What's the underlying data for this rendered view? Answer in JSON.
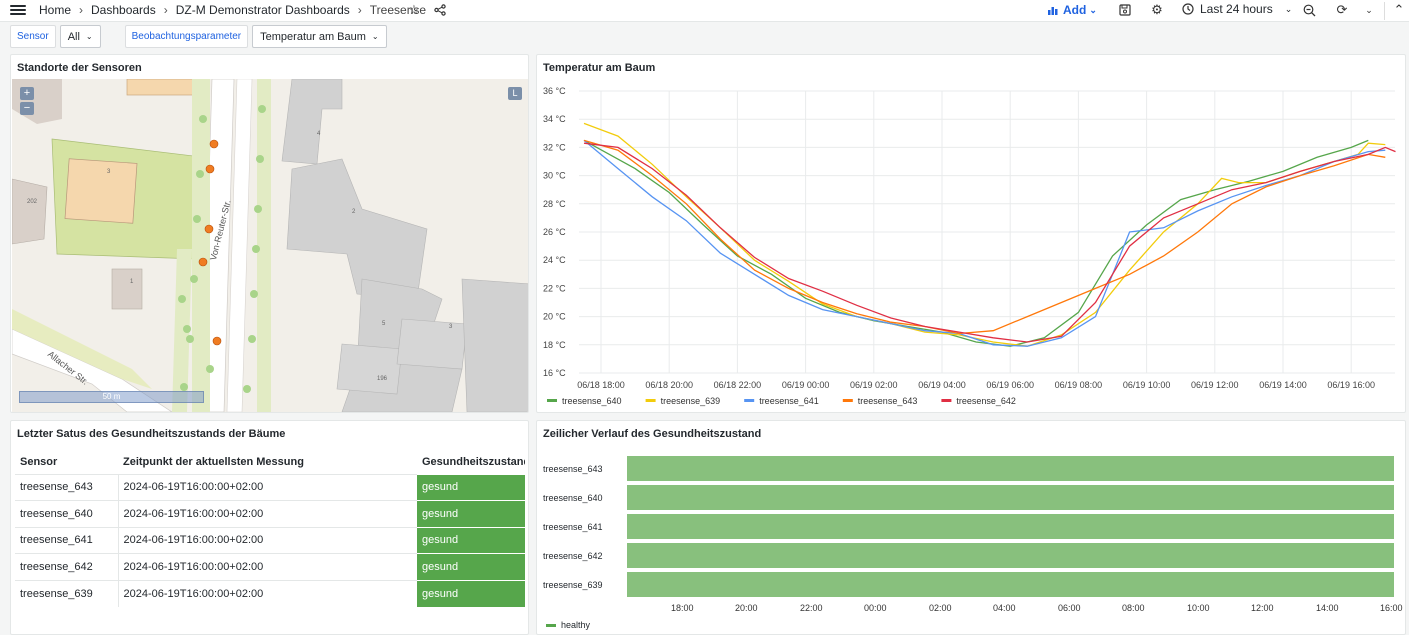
{
  "topbar": {
    "breadcrumbs": [
      "Home",
      "Dashboards",
      "DZ-M Demonstrator Dashboards",
      "Treesense"
    ],
    "add_label": "Add",
    "time_range": "Last 24 hours"
  },
  "variables": [
    {
      "label": "Sensor",
      "value": "All"
    },
    {
      "label": "Beobachtungsparameter",
      "value": "Temperatur am Baum"
    }
  ],
  "map_panel": {
    "title": "Standorte der Sensoren",
    "zoom_in": "+",
    "zoom_out": "−",
    "layer_button": "L",
    "scale_label": "50 m",
    "street_labels": [
      "Von-Reuter-Str.",
      "Allacher Str."
    ],
    "house_numbers": [
      "3",
      "202",
      "1",
      "4",
      "2",
      "5",
      "3",
      "196"
    ]
  },
  "temp_panel": {
    "title": "Temperatur am Baum"
  },
  "chart_data": {
    "type": "line",
    "title": "Temperatur am Baum",
    "y_ticks": [
      "36 °C",
      "34 °C",
      "32 °C",
      "30 °C",
      "28 °C",
      "26 °C",
      "24 °C",
      "22 °C",
      "20 °C",
      "18 °C",
      "16 °C"
    ],
    "ylim": [
      16,
      36
    ],
    "x_ticks": [
      "06/18 18:00",
      "06/18 20:00",
      "06/18 22:00",
      "06/19 00:00",
      "06/19 02:00",
      "06/19 04:00",
      "06/19 06:00",
      "06/19 08:00",
      "06/19 10:00",
      "06/19 12:00",
      "06/19 14:00",
      "06/19 16:00"
    ],
    "x_hours": [
      0,
      2,
      4,
      6,
      8,
      10,
      12,
      14,
      16,
      18,
      20,
      22
    ],
    "grid": true,
    "legend_placement": "bottom",
    "series": [
      {
        "name": "treesense_640",
        "color": "#56a64b",
        "points": [
          [
            -0.5,
            32.5
          ],
          [
            1,
            30.5
          ],
          [
            2,
            28.8
          ],
          [
            3,
            26.5
          ],
          [
            4,
            24.3
          ],
          [
            5,
            23.0
          ],
          [
            6,
            21.3
          ],
          [
            7,
            20.3
          ],
          [
            8,
            19.7
          ],
          [
            9,
            19.3
          ],
          [
            10,
            18.9
          ],
          [
            11,
            18.2
          ],
          [
            12,
            17.9
          ],
          [
            13,
            18.5
          ],
          [
            14,
            20.3
          ],
          [
            15,
            24.3
          ],
          [
            16,
            26.5
          ],
          [
            17,
            28.3
          ],
          [
            18,
            29.0
          ],
          [
            19,
            29.6
          ],
          [
            20,
            30.3
          ],
          [
            21,
            31.3
          ],
          [
            22,
            32.0
          ],
          [
            22.5,
            32.5
          ]
        ]
      },
      {
        "name": "treesense_639",
        "color": "#f2cc0c",
        "points": [
          [
            -0.5,
            33.7
          ],
          [
            0.5,
            32.8
          ],
          [
            1.5,
            30.8
          ],
          [
            2.5,
            28.5
          ],
          [
            3.5,
            26.3
          ],
          [
            4.5,
            24.0
          ],
          [
            5.5,
            22.5
          ],
          [
            6.5,
            20.9
          ],
          [
            7.5,
            20.0
          ],
          [
            8.5,
            19.5
          ],
          [
            9.5,
            18.9
          ],
          [
            10.5,
            18.7
          ],
          [
            11.5,
            18.2
          ],
          [
            12.5,
            17.9
          ],
          [
            13.5,
            18.7
          ],
          [
            14.5,
            20.3
          ],
          [
            15.5,
            23.3
          ],
          [
            16.5,
            26.0
          ],
          [
            17.5,
            28.0
          ],
          [
            18.2,
            29.8
          ],
          [
            18.7,
            29.5
          ],
          [
            19.5,
            29.5
          ],
          [
            20.5,
            30.3
          ],
          [
            21.5,
            31.0
          ],
          [
            22.2,
            31.5
          ],
          [
            22.5,
            32.3
          ],
          [
            23.0,
            32.2
          ]
        ]
      },
      {
        "name": "treesense_641",
        "color": "#5794f2",
        "points": [
          [
            -0.5,
            32.5
          ],
          [
            0.5,
            30.5
          ],
          [
            1.5,
            28.5
          ],
          [
            2.5,
            26.8
          ],
          [
            3.5,
            24.5
          ],
          [
            4.5,
            23.0
          ],
          [
            5.5,
            21.5
          ],
          [
            6.5,
            20.5
          ],
          [
            7.5,
            20.0
          ],
          [
            8.5,
            19.5
          ],
          [
            9.5,
            19.0
          ],
          [
            10.5,
            18.8
          ],
          [
            11.5,
            18.0
          ],
          [
            12.5,
            17.9
          ],
          [
            13.5,
            18.5
          ],
          [
            14.5,
            20.0
          ],
          [
            15.5,
            26.0
          ],
          [
            16.5,
            26.3
          ],
          [
            17.5,
            27.5
          ],
          [
            18.5,
            28.5
          ],
          [
            19.5,
            29.3
          ],
          [
            20.5,
            30.0
          ],
          [
            21.5,
            31.0
          ],
          [
            22.5,
            31.7
          ],
          [
            23.0,
            31.8
          ]
        ]
      },
      {
        "name": "treesense_643",
        "color": "#ff780a",
        "points": [
          [
            -0.5,
            32.5
          ],
          [
            0.5,
            31.8
          ],
          [
            1.5,
            30.0
          ],
          [
            2.5,
            28.0
          ],
          [
            3.5,
            25.5
          ],
          [
            4.5,
            23.3
          ],
          [
            5.5,
            22.0
          ],
          [
            6.5,
            21.0
          ],
          [
            7.5,
            20.2
          ],
          [
            8.5,
            19.6
          ],
          [
            9.5,
            19.3
          ],
          [
            10.5,
            18.8
          ],
          [
            11.5,
            19.0
          ],
          [
            12.5,
            20.0
          ],
          [
            13.5,
            21.0
          ],
          [
            14.5,
            22.0
          ],
          [
            15.5,
            23.0
          ],
          [
            16.5,
            24.3
          ],
          [
            17.5,
            26.0
          ],
          [
            18.5,
            28.0
          ],
          [
            19.5,
            29.2
          ],
          [
            20.5,
            30.0
          ],
          [
            21.5,
            30.7
          ],
          [
            22.5,
            31.5
          ],
          [
            23.0,
            31.3
          ]
        ]
      },
      {
        "name": "treesense_642",
        "color": "#e02f44",
        "points": [
          [
            -0.5,
            32.3
          ],
          [
            0.5,
            32.0
          ],
          [
            1.5,
            30.5
          ],
          [
            2.5,
            28.6
          ],
          [
            3.5,
            26.3
          ],
          [
            4.5,
            24.2
          ],
          [
            5.5,
            22.7
          ],
          [
            6.5,
            21.8
          ],
          [
            7.5,
            20.8
          ],
          [
            8.5,
            19.9
          ],
          [
            9.5,
            19.3
          ],
          [
            10.5,
            18.9
          ],
          [
            11.5,
            18.5
          ],
          [
            12.5,
            18.2
          ],
          [
            13.5,
            18.6
          ],
          [
            14.5,
            21.0
          ],
          [
            15.5,
            25.0
          ],
          [
            16.5,
            27.0
          ],
          [
            17.5,
            28.0
          ],
          [
            18.5,
            29.0
          ],
          [
            19.5,
            29.5
          ],
          [
            20.5,
            30.3
          ],
          [
            21.5,
            31.0
          ],
          [
            22.5,
            31.5
          ],
          [
            23.0,
            32.0
          ],
          [
            23.3,
            31.7
          ]
        ]
      }
    ]
  },
  "status_panel": {
    "title": "Letzter Satus des Gesundheitszustands der Bäume",
    "columns": [
      "Sensor",
      "Zeitpunkt der aktuellsten Messung",
      "Gesundheitszustand"
    ],
    "rows": [
      {
        "sensor": "treesense_643",
        "time": "2024-06-19T16:00:00+02:00",
        "status": "gesund"
      },
      {
        "sensor": "treesense_640",
        "time": "2024-06-19T16:00:00+02:00",
        "status": "gesund"
      },
      {
        "sensor": "treesense_641",
        "time": "2024-06-19T16:00:00+02:00",
        "status": "gesund"
      },
      {
        "sensor": "treesense_642",
        "time": "2024-06-19T16:00:00+02:00",
        "status": "gesund"
      },
      {
        "sensor": "treesense_639",
        "time": "2024-06-19T16:00:00+02:00",
        "status": "gesund"
      }
    ],
    "status_color": "#56a64b"
  },
  "timeline_panel": {
    "title": "Zeilicher Verlauf des Gesundheitszustand",
    "sensors": [
      "treesense_643",
      "treesense_640",
      "treesense_641",
      "treesense_642",
      "treesense_639"
    ],
    "x_ticks": [
      "18:00",
      "20:00",
      "22:00",
      "00:00",
      "02:00",
      "04:00",
      "06:00",
      "08:00",
      "10:00",
      "12:00",
      "14:00",
      "16:00"
    ],
    "legend": "healthy",
    "bar_color": "#88c07d"
  }
}
